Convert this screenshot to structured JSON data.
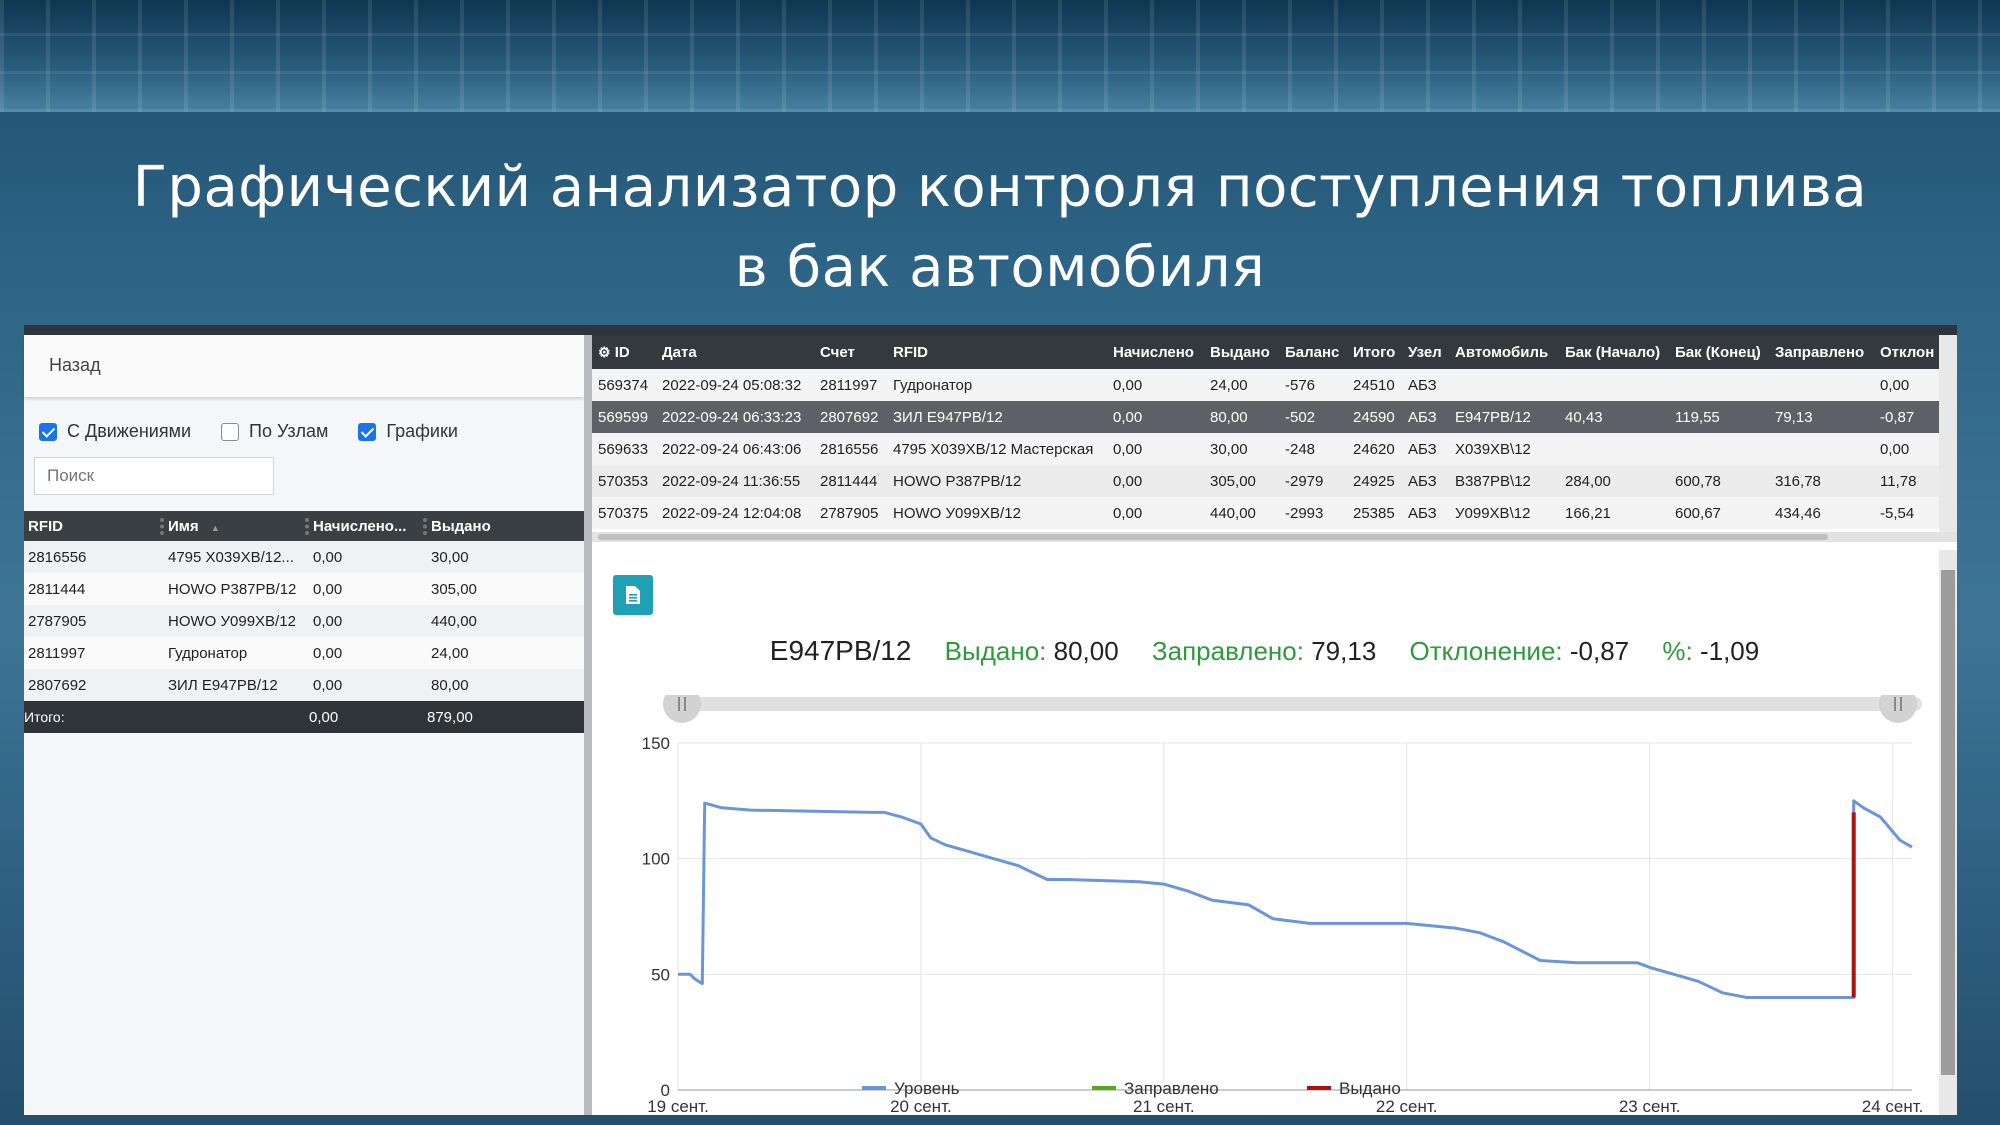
{
  "hero": {
    "line1": "Графический анализатор контроля поступления топлива",
    "line2": "в бак автомобиля"
  },
  "left_panel": {
    "back_label": "Назад",
    "filters": [
      {
        "label": "С Движениями",
        "checked": true
      },
      {
        "label": "По Узлам",
        "checked": false
      },
      {
        "label": "Графики",
        "checked": true
      }
    ],
    "search_placeholder": "Поиск",
    "table": {
      "columns": [
        "RFID",
        "Имя",
        "Начислено...",
        "Выдано"
      ],
      "sort_indicator": "▲",
      "rows": [
        [
          "2816556",
          "4795 Х039ХВ/12...",
          "0,00",
          "30,00"
        ],
        [
          "2811444",
          "HOWO Р387РВ/12",
          "0,00",
          "305,00"
        ],
        [
          "2787905",
          "HOWO У099ХВ/12",
          "0,00",
          "440,00"
        ],
        [
          "2811997",
          "Гудронатор",
          "0,00",
          "24,00"
        ],
        [
          "2807692",
          "ЗИЛ Е947РВ/12",
          "0,00",
          "80,00"
        ]
      ],
      "footer": [
        "Итого:",
        "",
        "0,00",
        "879,00"
      ]
    }
  },
  "right_panel": {
    "table": {
      "columns": [
        "ID",
        "Дата",
        "Счет",
        "RFID",
        "Начислено",
        "Выдано",
        "Баланс",
        "Итого",
        "Узел",
        "Автомобиль",
        "Бак (Начало)",
        "Бак (Конец)",
        "Заправлено",
        "Отклон"
      ],
      "rows": [
        [
          "569374",
          "2022-09-24 05:08:32",
          "2811997",
          "Гудронатор",
          "0,00",
          "24,00",
          "-576",
          "24510",
          "АБЗ",
          "",
          "",
          "",
          "",
          "0,00"
        ],
        [
          "569599",
          "2022-09-24 06:33:23",
          "2807692",
          "ЗИЛ Е947РВ/12",
          "0,00",
          "80,00",
          "-502",
          "24590",
          "АБЗ",
          "Е947РВ/12",
          "40,43",
          "119,55",
          "79,13",
          "-0,87"
        ],
        [
          "569633",
          "2022-09-24 06:43:06",
          "2816556",
          "4795 Х039ХВ/12 Мастерская",
          "0,00",
          "30,00",
          "-248",
          "24620",
          "АБЗ",
          "Х039ХВ\\12",
          "",
          "",
          "",
          "0,00"
        ],
        [
          "570353",
          "2022-09-24 11:36:55",
          "2811444",
          "HOWO Р387РВ/12",
          "0,00",
          "305,00",
          "-2979",
          "24925",
          "АБЗ",
          "В387РВ\\12",
          "284,00",
          "600,78",
          "316,78",
          "11,78"
        ],
        [
          "570375",
          "2022-09-24 12:04:08",
          "2787905",
          "HOWO У099ХВ/12",
          "0,00",
          "440,00",
          "-2993",
          "25385",
          "АБЗ",
          "У099ХВ\\12",
          "166,21",
          "600,67",
          "434,46",
          "-5,54"
        ]
      ],
      "selected_row": 1
    },
    "info": {
      "vehicle": "Е947РВ/12",
      "issued_label": "Выдано:",
      "issued_value": "80,00",
      "filled_label": "Заправлено:",
      "filled_value": "79,13",
      "deviation_label": "Отклонение:",
      "deviation_value": "-0,87",
      "percent_label": "%:",
      "percent_value": "-1,09"
    }
  },
  "colors": {
    "level": "#6a96d8",
    "filled": "#55aa22",
    "issued": "#aa1111",
    "green_label": "#2f9a3b",
    "export_button": "#1fa0b5"
  },
  "chart_data": {
    "type": "line",
    "x_ticks": [
      "19 сент.",
      "20 сент.",
      "21 сент.",
      "22 сент.",
      "23 сент.",
      "24 сент."
    ],
    "y_ticks": [
      "0",
      "50",
      "100",
      "150"
    ],
    "ylim": [
      0,
      150
    ],
    "xlim_days": [
      0,
      5.08
    ],
    "grid": true,
    "legend_position": "bottom",
    "series": [
      {
        "name": "Уровень",
        "x_day": [
          0.0,
          0.05,
          0.07,
          0.1,
          0.11,
          0.18,
          0.3,
          0.8,
          0.85,
          0.92,
          1.0,
          1.04,
          1.1,
          1.2,
          1.3,
          1.4,
          1.52,
          1.6,
          1.9,
          2.0,
          2.1,
          2.2,
          2.35,
          2.45,
          2.6,
          2.8,
          3.0,
          3.2,
          3.3,
          3.4,
          3.55,
          3.7,
          3.95,
          4.0,
          4.1,
          4.2,
          4.3,
          4.4,
          4.7,
          4.84,
          4.84,
          4.88,
          4.95,
          5.03,
          5.08
        ],
        "y": [
          50,
          50,
          48,
          46,
          124,
          122,
          121,
          120,
          120,
          118,
          115,
          109,
          106,
          103,
          100,
          97,
          91,
          91,
          90,
          89,
          86,
          82,
          80,
          74,
          72,
          72,
          72,
          70,
          68,
          64,
          56,
          55,
          55,
          53,
          50,
          47,
          42,
          40,
          40,
          40,
          125,
          122,
          118,
          108,
          105
        ]
      },
      {
        "name": "Заправлено",
        "x_day": [],
        "y": []
      },
      {
        "name": "Выдано",
        "x_day": [
          4.84,
          4.84
        ],
        "y": [
          40,
          120
        ]
      }
    ]
  }
}
